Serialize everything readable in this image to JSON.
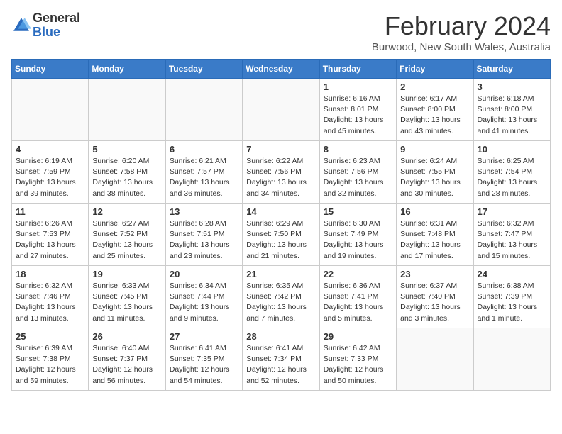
{
  "header": {
    "logo_general": "General",
    "logo_blue": "Blue",
    "main_title": "February 2024",
    "subtitle": "Burwood, New South Wales, Australia"
  },
  "weekdays": [
    "Sunday",
    "Monday",
    "Tuesday",
    "Wednesday",
    "Thursday",
    "Friday",
    "Saturday"
  ],
  "weeks": [
    [
      {
        "day": "",
        "info": ""
      },
      {
        "day": "",
        "info": ""
      },
      {
        "day": "",
        "info": ""
      },
      {
        "day": "",
        "info": ""
      },
      {
        "day": "1",
        "info": "Sunrise: 6:16 AM\nSunset: 8:01 PM\nDaylight: 13 hours\nand 45 minutes."
      },
      {
        "day": "2",
        "info": "Sunrise: 6:17 AM\nSunset: 8:00 PM\nDaylight: 13 hours\nand 43 minutes."
      },
      {
        "day": "3",
        "info": "Sunrise: 6:18 AM\nSunset: 8:00 PM\nDaylight: 13 hours\nand 41 minutes."
      }
    ],
    [
      {
        "day": "4",
        "info": "Sunrise: 6:19 AM\nSunset: 7:59 PM\nDaylight: 13 hours\nand 39 minutes."
      },
      {
        "day": "5",
        "info": "Sunrise: 6:20 AM\nSunset: 7:58 PM\nDaylight: 13 hours\nand 38 minutes."
      },
      {
        "day": "6",
        "info": "Sunrise: 6:21 AM\nSunset: 7:57 PM\nDaylight: 13 hours\nand 36 minutes."
      },
      {
        "day": "7",
        "info": "Sunrise: 6:22 AM\nSunset: 7:56 PM\nDaylight: 13 hours\nand 34 minutes."
      },
      {
        "day": "8",
        "info": "Sunrise: 6:23 AM\nSunset: 7:56 PM\nDaylight: 13 hours\nand 32 minutes."
      },
      {
        "day": "9",
        "info": "Sunrise: 6:24 AM\nSunset: 7:55 PM\nDaylight: 13 hours\nand 30 minutes."
      },
      {
        "day": "10",
        "info": "Sunrise: 6:25 AM\nSunset: 7:54 PM\nDaylight: 13 hours\nand 28 minutes."
      }
    ],
    [
      {
        "day": "11",
        "info": "Sunrise: 6:26 AM\nSunset: 7:53 PM\nDaylight: 13 hours\nand 27 minutes."
      },
      {
        "day": "12",
        "info": "Sunrise: 6:27 AM\nSunset: 7:52 PM\nDaylight: 13 hours\nand 25 minutes."
      },
      {
        "day": "13",
        "info": "Sunrise: 6:28 AM\nSunset: 7:51 PM\nDaylight: 13 hours\nand 23 minutes."
      },
      {
        "day": "14",
        "info": "Sunrise: 6:29 AM\nSunset: 7:50 PM\nDaylight: 13 hours\nand 21 minutes."
      },
      {
        "day": "15",
        "info": "Sunrise: 6:30 AM\nSunset: 7:49 PM\nDaylight: 13 hours\nand 19 minutes."
      },
      {
        "day": "16",
        "info": "Sunrise: 6:31 AM\nSunset: 7:48 PM\nDaylight: 13 hours\nand 17 minutes."
      },
      {
        "day": "17",
        "info": "Sunrise: 6:32 AM\nSunset: 7:47 PM\nDaylight: 13 hours\nand 15 minutes."
      }
    ],
    [
      {
        "day": "18",
        "info": "Sunrise: 6:32 AM\nSunset: 7:46 PM\nDaylight: 13 hours\nand 13 minutes."
      },
      {
        "day": "19",
        "info": "Sunrise: 6:33 AM\nSunset: 7:45 PM\nDaylight: 13 hours\nand 11 minutes."
      },
      {
        "day": "20",
        "info": "Sunrise: 6:34 AM\nSunset: 7:44 PM\nDaylight: 13 hours\nand 9 minutes."
      },
      {
        "day": "21",
        "info": "Sunrise: 6:35 AM\nSunset: 7:42 PM\nDaylight: 13 hours\nand 7 minutes."
      },
      {
        "day": "22",
        "info": "Sunrise: 6:36 AM\nSunset: 7:41 PM\nDaylight: 13 hours\nand 5 minutes."
      },
      {
        "day": "23",
        "info": "Sunrise: 6:37 AM\nSunset: 7:40 PM\nDaylight: 13 hours\nand 3 minutes."
      },
      {
        "day": "24",
        "info": "Sunrise: 6:38 AM\nSunset: 7:39 PM\nDaylight: 13 hours\nand 1 minute."
      }
    ],
    [
      {
        "day": "25",
        "info": "Sunrise: 6:39 AM\nSunset: 7:38 PM\nDaylight: 12 hours\nand 59 minutes."
      },
      {
        "day": "26",
        "info": "Sunrise: 6:40 AM\nSunset: 7:37 PM\nDaylight: 12 hours\nand 56 minutes."
      },
      {
        "day": "27",
        "info": "Sunrise: 6:41 AM\nSunset: 7:35 PM\nDaylight: 12 hours\nand 54 minutes."
      },
      {
        "day": "28",
        "info": "Sunrise: 6:41 AM\nSunset: 7:34 PM\nDaylight: 12 hours\nand 52 minutes."
      },
      {
        "day": "29",
        "info": "Sunrise: 6:42 AM\nSunset: 7:33 PM\nDaylight: 12 hours\nand 50 minutes."
      },
      {
        "day": "",
        "info": ""
      },
      {
        "day": "",
        "info": ""
      }
    ]
  ]
}
